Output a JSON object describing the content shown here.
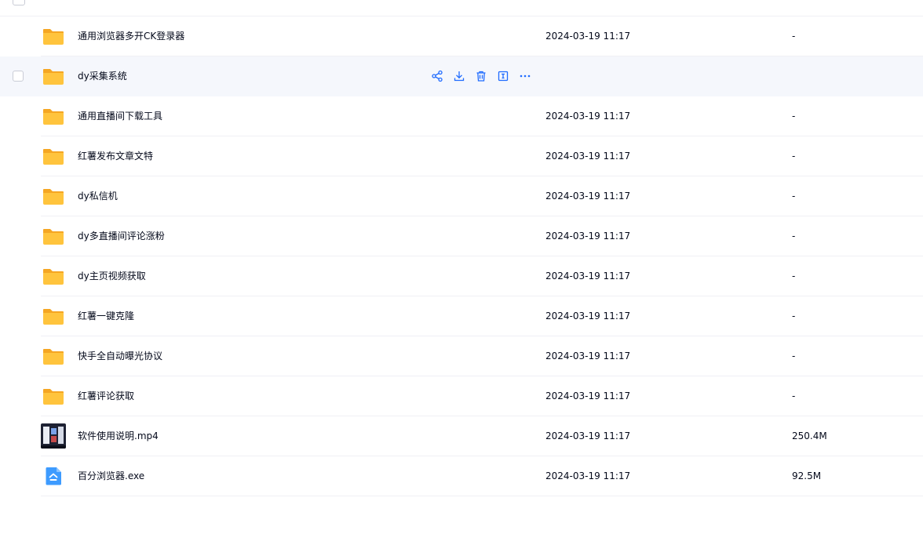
{
  "colors": {
    "folder": "#ffc43d",
    "folder_back": "#f5a623",
    "action_icon": "#1f6bff",
    "hover_row": "#f5f7fc",
    "divider": "#f0f0f5",
    "exe_icon": "#3d9bff"
  },
  "files": [
    {
      "name": "通用浏览器多开CK登录器",
      "date": "2024-03-19 11:17",
      "size": "-",
      "icon": "folder-icon"
    },
    {
      "name": "dy采集系统",
      "date": "",
      "size": "",
      "icon": "folder-icon"
    },
    {
      "name": "通用直播间下载工具",
      "date": "2024-03-19 11:17",
      "size": "-",
      "icon": "folder-icon"
    },
    {
      "name": "红薯发布文章文特",
      "date": "2024-03-19 11:17",
      "size": "-",
      "icon": "folder-icon"
    },
    {
      "name": "dy私信机",
      "date": "2024-03-19 11:17",
      "size": "-",
      "icon": "folder-icon"
    },
    {
      "name": "dy多直播间评论涨粉",
      "date": "2024-03-19 11:17",
      "size": "-",
      "icon": "folder-icon"
    },
    {
      "name": "dy主页视频获取",
      "date": "2024-03-19 11:17",
      "size": "-",
      "icon": "folder-icon"
    },
    {
      "name": "红薯一键克隆",
      "date": "2024-03-19 11:17",
      "size": "-",
      "icon": "folder-icon"
    },
    {
      "name": "快手全自动曝光协议",
      "date": "2024-03-19 11:17",
      "size": "-",
      "icon": "folder-icon"
    },
    {
      "name": "红薯评论获取",
      "date": "2024-03-19 11:17",
      "size": "-",
      "icon": "folder-icon"
    },
    {
      "name": "软件使用说明.mp4",
      "date": "2024-03-19 11:17",
      "size": "250.4M",
      "icon": "video-thumbnail"
    },
    {
      "name": "百分浏览器.exe",
      "date": "2024-03-19 11:17",
      "size": "92.5M",
      "icon": "exe-file-icon"
    }
  ],
  "hover_actions": [
    "share-icon",
    "download-icon",
    "delete-icon",
    "rename-icon",
    "more-icon"
  ]
}
